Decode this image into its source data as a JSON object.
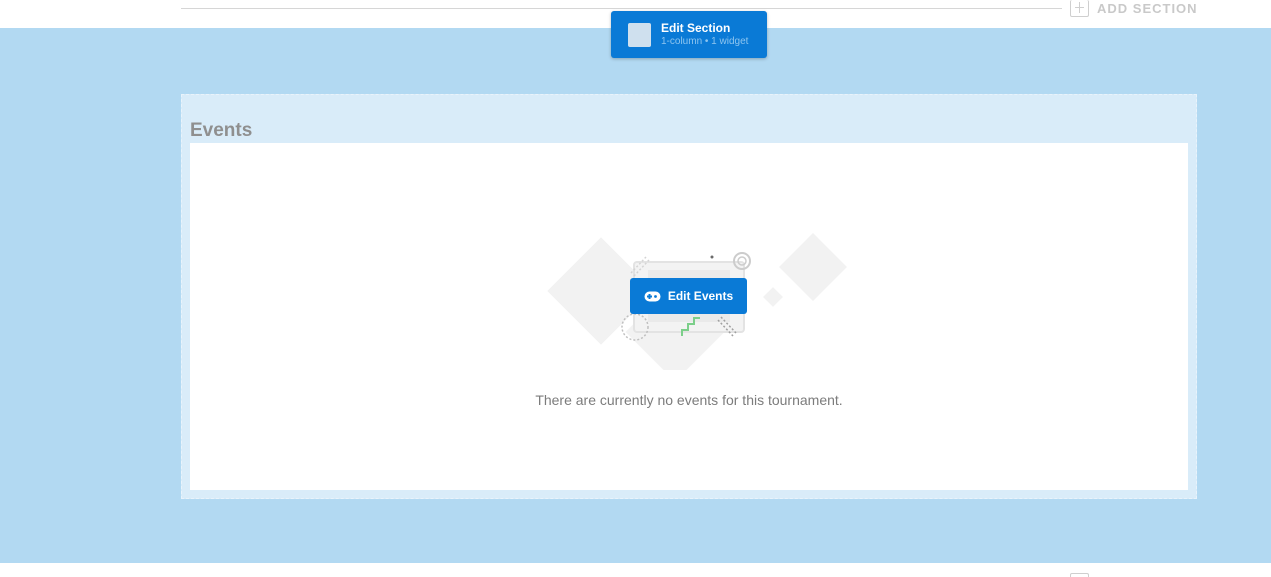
{
  "toolbar": {
    "add_section_label": "ADD SECTION"
  },
  "section_editor": {
    "title": "Edit Section",
    "subtitle": "1-column • 1 widget"
  },
  "widget": {
    "title": "Events",
    "button_label": "Edit Events",
    "empty_message": "There are currently no events for this tournament."
  },
  "colors": {
    "accent": "#0a7ad6",
    "section_background": "#b2d9f2",
    "widget_background": "#d9ecf9"
  }
}
